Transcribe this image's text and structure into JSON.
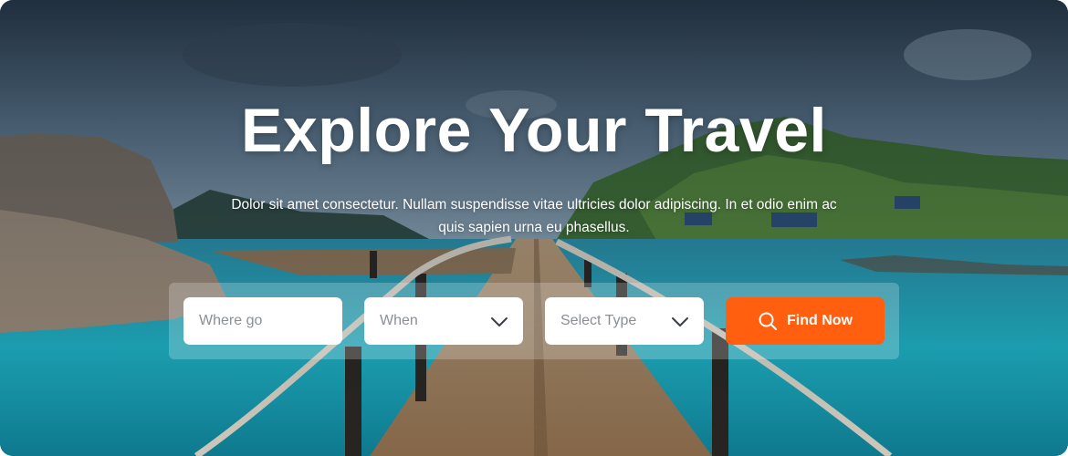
{
  "hero": {
    "title": "Explore Your Travel",
    "subtitle": "Dolor sit amet consectetur. Nullam suspendisse vitae ultricies dolor adipiscing. In et odio enim ac quis sapien urna eu phasellus."
  },
  "search": {
    "where_placeholder": "Where go",
    "when_label": "When",
    "type_label": "Select Type",
    "button_label": "Find Now",
    "button_icon": "search-icon",
    "dropdown_icon": "chevron-down-icon"
  },
  "colors": {
    "accent": "#ff5f0f",
    "field_bg": "#ffffff",
    "placeholder_text": "#8a8f96"
  }
}
